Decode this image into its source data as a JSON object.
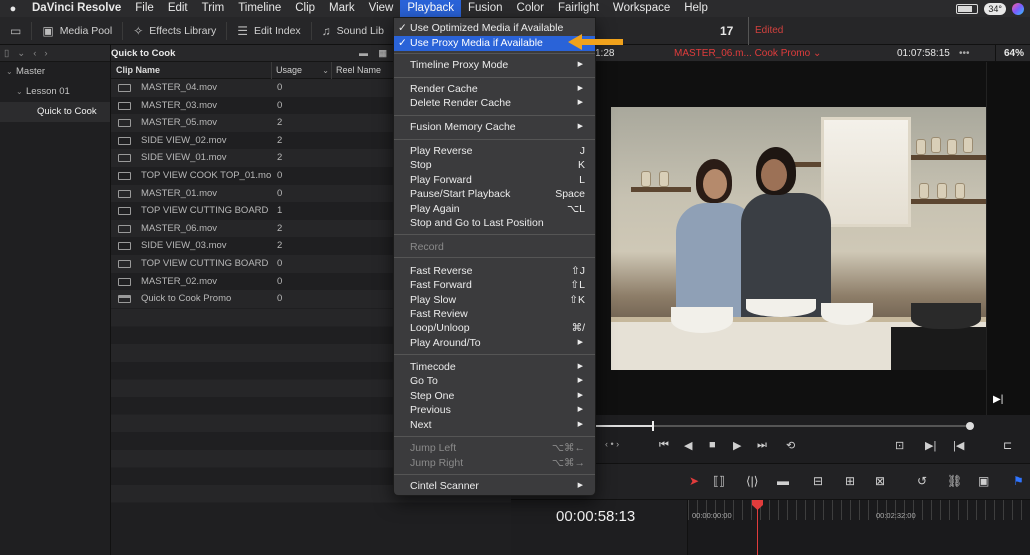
{
  "menubar": {
    "app": "DaVinci Resolve",
    "items": [
      "File",
      "Edit",
      "Trim",
      "Timeline",
      "Clip",
      "Mark",
      "View",
      "Playback",
      "Fusion",
      "Color",
      "Fairlight",
      "Workspace",
      "Help"
    ],
    "active": "Playback",
    "temp": "34°"
  },
  "toolbar": {
    "media_pool": "Media Pool",
    "effects_library": "Effects Library",
    "edit_index": "Edit Index",
    "sound_library": "Sound Lib",
    "counter": "17",
    "edited": "Edited"
  },
  "bins": {
    "items": [
      {
        "label": "Master"
      },
      {
        "label": "Lesson 01"
      },
      {
        "label": "Quick to Cook"
      }
    ]
  },
  "pool": {
    "title": "Quick to Cook",
    "col_name": "Clip Name",
    "col_usage": "Usage",
    "col_reel": "Reel Name",
    "clips": [
      {
        "name": "MASTER_04.mov",
        "usage": "0"
      },
      {
        "name": "MASTER_03.mov",
        "usage": "0"
      },
      {
        "name": "MASTER_05.mov",
        "usage": "2"
      },
      {
        "name": "SIDE VIEW_02.mov",
        "usage": "2"
      },
      {
        "name": "SIDE VIEW_01.mov",
        "usage": "2"
      },
      {
        "name": "TOP VIEW COOK TOP_01.mov",
        "usage": "0"
      },
      {
        "name": "MASTER_01.mov",
        "usage": "0"
      },
      {
        "name": "TOP VIEW CUTTING BOARD 0...",
        "usage": "1"
      },
      {
        "name": "MASTER_06.mov",
        "usage": "2"
      },
      {
        "name": "SIDE VIEW_03.mov",
        "usage": "2"
      },
      {
        "name": "TOP VIEW CUTTING BOARD 0...",
        "usage": "0"
      },
      {
        "name": "MASTER_02.mov",
        "usage": "0"
      },
      {
        "name": "Quick to Cook Promo",
        "usage": "0"
      }
    ]
  },
  "viewer": {
    "tc_left": "1:28",
    "clip_name": "MASTER_06.m... Cook Promo",
    "tc_right": "01:07:58:15",
    "more": "•••",
    "zoom": "64%"
  },
  "timeline": {
    "timecode": "00:00:58:13",
    "ruler_start": "00:00:00:00",
    "ruler_mark": "00:02:32:00"
  },
  "playback_menu": {
    "items": [
      {
        "label": "Use Optimized Media if Available",
        "checked": true
      },
      {
        "label": "Use Proxy Media if Available",
        "checked": true,
        "highlighted": true
      },
      {
        "label": "Timeline Proxy Mode",
        "submenu": true
      },
      {
        "label": "Render Cache",
        "submenu": true
      },
      {
        "label": "Delete Render Cache",
        "submenu": true
      },
      {
        "label": "Fusion Memory Cache",
        "submenu": true
      },
      {
        "label": "Play Reverse",
        "shortcut": "J"
      },
      {
        "label": "Stop",
        "shortcut": "K"
      },
      {
        "label": "Play Forward",
        "shortcut": "L"
      },
      {
        "label": "Pause/Start Playback",
        "shortcut": "Space"
      },
      {
        "label": "Play Again",
        "shortcut": "⌥L"
      },
      {
        "label": "Stop and Go to Last Position"
      },
      {
        "label": "Record",
        "disabled": true
      },
      {
        "label": "Fast Reverse",
        "shortcut": "⇧J"
      },
      {
        "label": "Fast Forward",
        "shortcut": "⇧L"
      },
      {
        "label": "Play Slow",
        "shortcut": "⇧K"
      },
      {
        "label": "Fast Review"
      },
      {
        "label": "Loop/Unloop",
        "shortcut": "⌘/"
      },
      {
        "label": "Play Around/To",
        "submenu": true
      },
      {
        "label": "Timecode",
        "submenu": true
      },
      {
        "label": "Go To",
        "submenu": true
      },
      {
        "label": "Step One",
        "submenu": true
      },
      {
        "label": "Previous",
        "submenu": true
      },
      {
        "label": "Next",
        "submenu": true
      },
      {
        "label": "Jump Left",
        "shortcut": "⌥⌘←",
        "disabled": true
      },
      {
        "label": "Jump Right",
        "shortcut": "⌥⌘→",
        "disabled": true
      },
      {
        "label": "Cintel Scanner",
        "submenu": true
      }
    ]
  },
  "colors": {
    "accent": "#2a63d8",
    "arrow": "#f0a21c",
    "edited": "#d0413e"
  }
}
